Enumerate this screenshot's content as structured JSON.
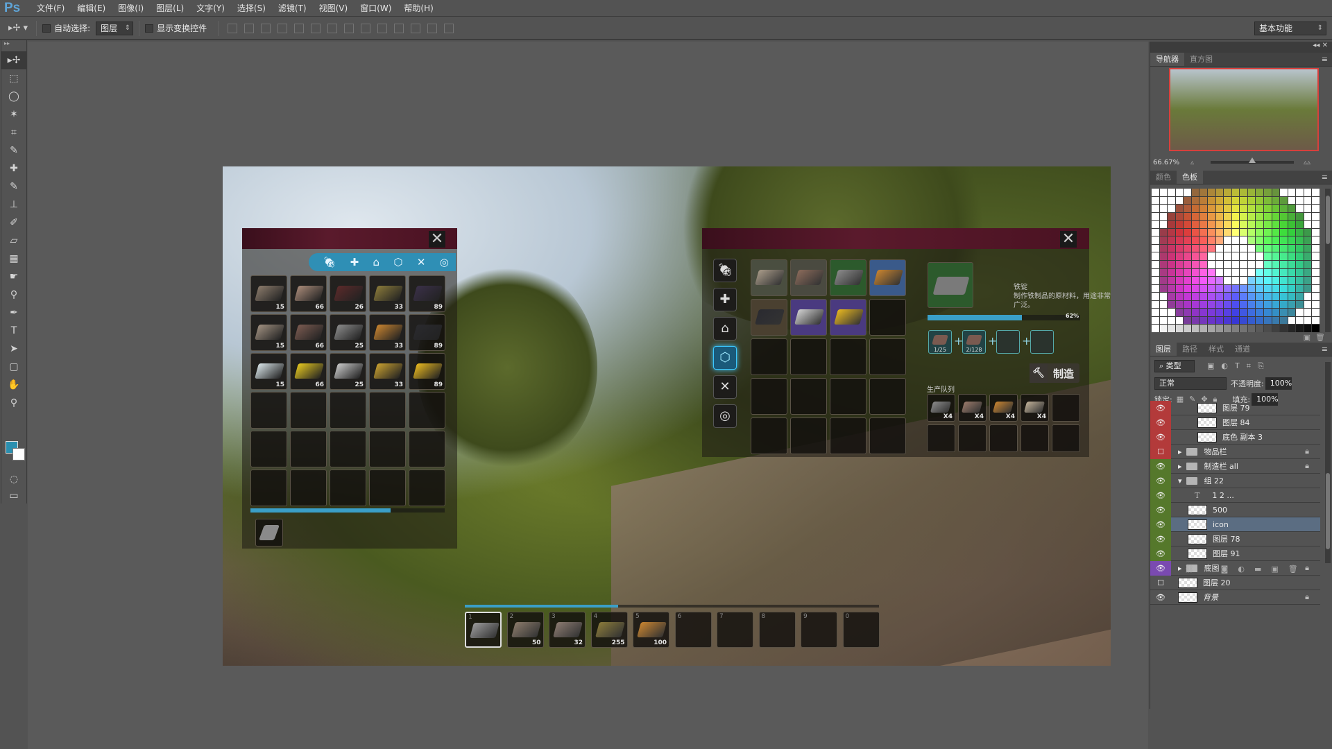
{
  "app": {
    "logo": "Ps"
  },
  "menu": [
    "文件(F)",
    "编辑(E)",
    "图像(I)",
    "图层(L)",
    "文字(Y)",
    "选择(S)",
    "滤镜(T)",
    "视图(V)",
    "窗口(W)",
    "帮助(H)"
  ],
  "options": {
    "auto_select_label": "自动选择:",
    "auto_select_value": "图层",
    "show_transform_label": "显示变换控件",
    "workspace": "基本功能"
  },
  "tools": [
    "move",
    "marquee",
    "lasso",
    "magic-wand",
    "crop",
    "eyedropper",
    "healing",
    "brush",
    "stamp",
    "history-brush",
    "eraser",
    "gradient",
    "smudge",
    "dodge",
    "pen",
    "type",
    "path-select",
    "shape",
    "hand",
    "zoom"
  ],
  "colors": {
    "foreground": "#2a8fb0",
    "background": "#ffffff"
  },
  "navigator": {
    "tabs": [
      "导航器",
      "直方图"
    ],
    "zoom": "66.67%"
  },
  "swatches": {
    "tabs": [
      "颜色",
      "色板"
    ]
  },
  "layers": {
    "tabs": [
      "图层",
      "路径",
      "样式",
      "通道"
    ],
    "filter": "类型",
    "blend_mode": "正常",
    "opacity_label": "不透明度:",
    "opacity": "100%",
    "lock_label": "锁定:",
    "fill_label": "填充:",
    "fill": "100%",
    "items": [
      {
        "name": "图层 79",
        "type": "layer",
        "eye": "red",
        "indent": 2
      },
      {
        "name": "图层 84",
        "type": "layer",
        "eye": "red",
        "indent": 2
      },
      {
        "name": "底色 副本 3",
        "type": "layer",
        "eye": "red",
        "indent": 2
      },
      {
        "name": "物品栏",
        "type": "folder",
        "eye": "red-off",
        "indent": 0,
        "locked": true,
        "collapsed": true
      },
      {
        "name": "制造栏 all",
        "type": "folder",
        "eye": "green",
        "indent": 0,
        "locked": true,
        "collapsed": true
      },
      {
        "name": "组 22",
        "type": "folder",
        "eye": "green",
        "indent": 0,
        "collapsed": false
      },
      {
        "name": "1          2          ...",
        "type": "text",
        "eye": "green",
        "indent": 1
      },
      {
        "name": "500",
        "type": "layer",
        "eye": "green",
        "indent": 1
      },
      {
        "name": "icon",
        "type": "layer",
        "eye": "green",
        "indent": 1,
        "selected": true
      },
      {
        "name": "图层 78",
        "type": "layer",
        "eye": "green",
        "indent": 1
      },
      {
        "name": "图层 91",
        "type": "layer",
        "eye": "green",
        "indent": 1
      },
      {
        "name": "底图",
        "type": "folder",
        "eye": "violet",
        "indent": 0,
        "locked": true,
        "collapsed": true
      },
      {
        "name": "图层 20",
        "type": "layer",
        "eye": "off",
        "indent": 0
      },
      {
        "name": "背景",
        "type": "layer",
        "eye": "normal",
        "indent": 0,
        "locked": true
      }
    ]
  },
  "game": {
    "inventory": {
      "close": "✕",
      "category_icons": [
        "food",
        "medical",
        "building",
        "resources",
        "weapons",
        "traps"
      ],
      "items": [
        {
          "name": "stone",
          "count": "15",
          "color": "#8a7a6a"
        },
        {
          "name": "wood-log",
          "count": "66",
          "color": "#a88a78"
        },
        {
          "name": "iron-ore",
          "count": "26",
          "color": "#5a2a2a"
        },
        {
          "name": "gold-ore",
          "count": "33",
          "color": "#8a7a3a"
        },
        {
          "name": "dark-ore",
          "count": "89",
          "color": "#3a3048"
        },
        {
          "name": "stone-block",
          "count": "15",
          "color": "#a09080"
        },
        {
          "name": "wood-plank",
          "count": "66",
          "color": "#7a5a50"
        },
        {
          "name": "iron-ingot",
          "count": "25",
          "color": "#8a8a8a"
        },
        {
          "name": "copper-ingot",
          "count": "33",
          "color": "#c88430"
        },
        {
          "name": "dark-ingot",
          "count": "89",
          "color": "#2a2a2e"
        },
        {
          "name": "salt",
          "count": "15",
          "color": "#d8e4e8"
        },
        {
          "name": "sulfur",
          "count": "66",
          "color": "#e6c820"
        },
        {
          "name": "silver-ingot",
          "count": "25",
          "color": "#c8c8c8"
        },
        {
          "name": "gold-nugget",
          "count": "33",
          "color": "#c8a030"
        },
        {
          "name": "gold-ingot",
          "count": "89",
          "color": "#e8b820"
        }
      ],
      "weight_progress": 0.72,
      "equipped_tool": "axe"
    },
    "crafting": {
      "close": "✕",
      "categories": [
        "food",
        "medical",
        "building",
        "resources",
        "weapons",
        "traps"
      ],
      "active_category": 3,
      "recipes": [
        {
          "name": "stone-block",
          "bg": "#4a4e40",
          "color": "#a89a88"
        },
        {
          "name": "wood-plank",
          "bg": "#4a4a40",
          "color": "#8a6a5a"
        },
        {
          "name": "iron-ingot",
          "bg": "#2c5a2c",
          "color": "#8a8a8a"
        },
        {
          "name": "copper-ingot",
          "bg": "#3a5a8a",
          "color": "#c88430"
        },
        {
          "name": "dark-ingot",
          "bg": "#4a4030",
          "color": "#2a2a30"
        },
        {
          "name": "silver-ingot",
          "bg": "#4a3a80",
          "color": "#d0d0d0"
        },
        {
          "name": "gold-ingot",
          "bg": "#4a3a80",
          "color": "#e8b820"
        }
      ],
      "selected": {
        "name": "铁锭",
        "description": "制作铁制品的原材料，用途非常广泛。",
        "progress_percent": 62,
        "progress_label": "62%",
        "ingredients": [
          {
            "name": "iron-ore",
            "count": "1/25"
          },
          {
            "name": "wood-log",
            "count": "2/128"
          },
          {
            "name": "empty",
            "count": ""
          },
          {
            "name": "empty",
            "count": ""
          }
        ]
      },
      "make_label": "制造",
      "queue_label": "生产队列",
      "queue": [
        {
          "name": "iron-ingot",
          "count": "X4",
          "color": "#8a8a8a"
        },
        {
          "name": "wood-plank",
          "count": "X4",
          "color": "#9a7a6a"
        },
        {
          "name": "copper-ingot",
          "count": "X4",
          "color": "#c88430"
        },
        {
          "name": "stone-block",
          "count": "X4",
          "color": "#c0b098"
        }
      ]
    },
    "hotbar": {
      "progress": 0.37,
      "slots": [
        {
          "key": "1",
          "item": "axe",
          "count": "",
          "color": "#9a9a9a",
          "selected": true
        },
        {
          "key": "2",
          "item": "stone",
          "count": "50",
          "color": "#8a7a6a"
        },
        {
          "key": "3",
          "item": "wood-plank",
          "count": "32",
          "color": "#8a7a70"
        },
        {
          "key": "4",
          "item": "gold-ore",
          "count": "255",
          "color": "#8a7a3a"
        },
        {
          "key": "5",
          "item": "copper-ingot",
          "count": "100",
          "color": "#c88430"
        },
        {
          "key": "6",
          "item": "",
          "count": ""
        },
        {
          "key": "7",
          "item": "",
          "count": ""
        },
        {
          "key": "8",
          "item": "",
          "count": ""
        },
        {
          "key": "9",
          "item": "",
          "count": ""
        },
        {
          "key": "0",
          "item": "",
          "count": ""
        }
      ]
    }
  }
}
